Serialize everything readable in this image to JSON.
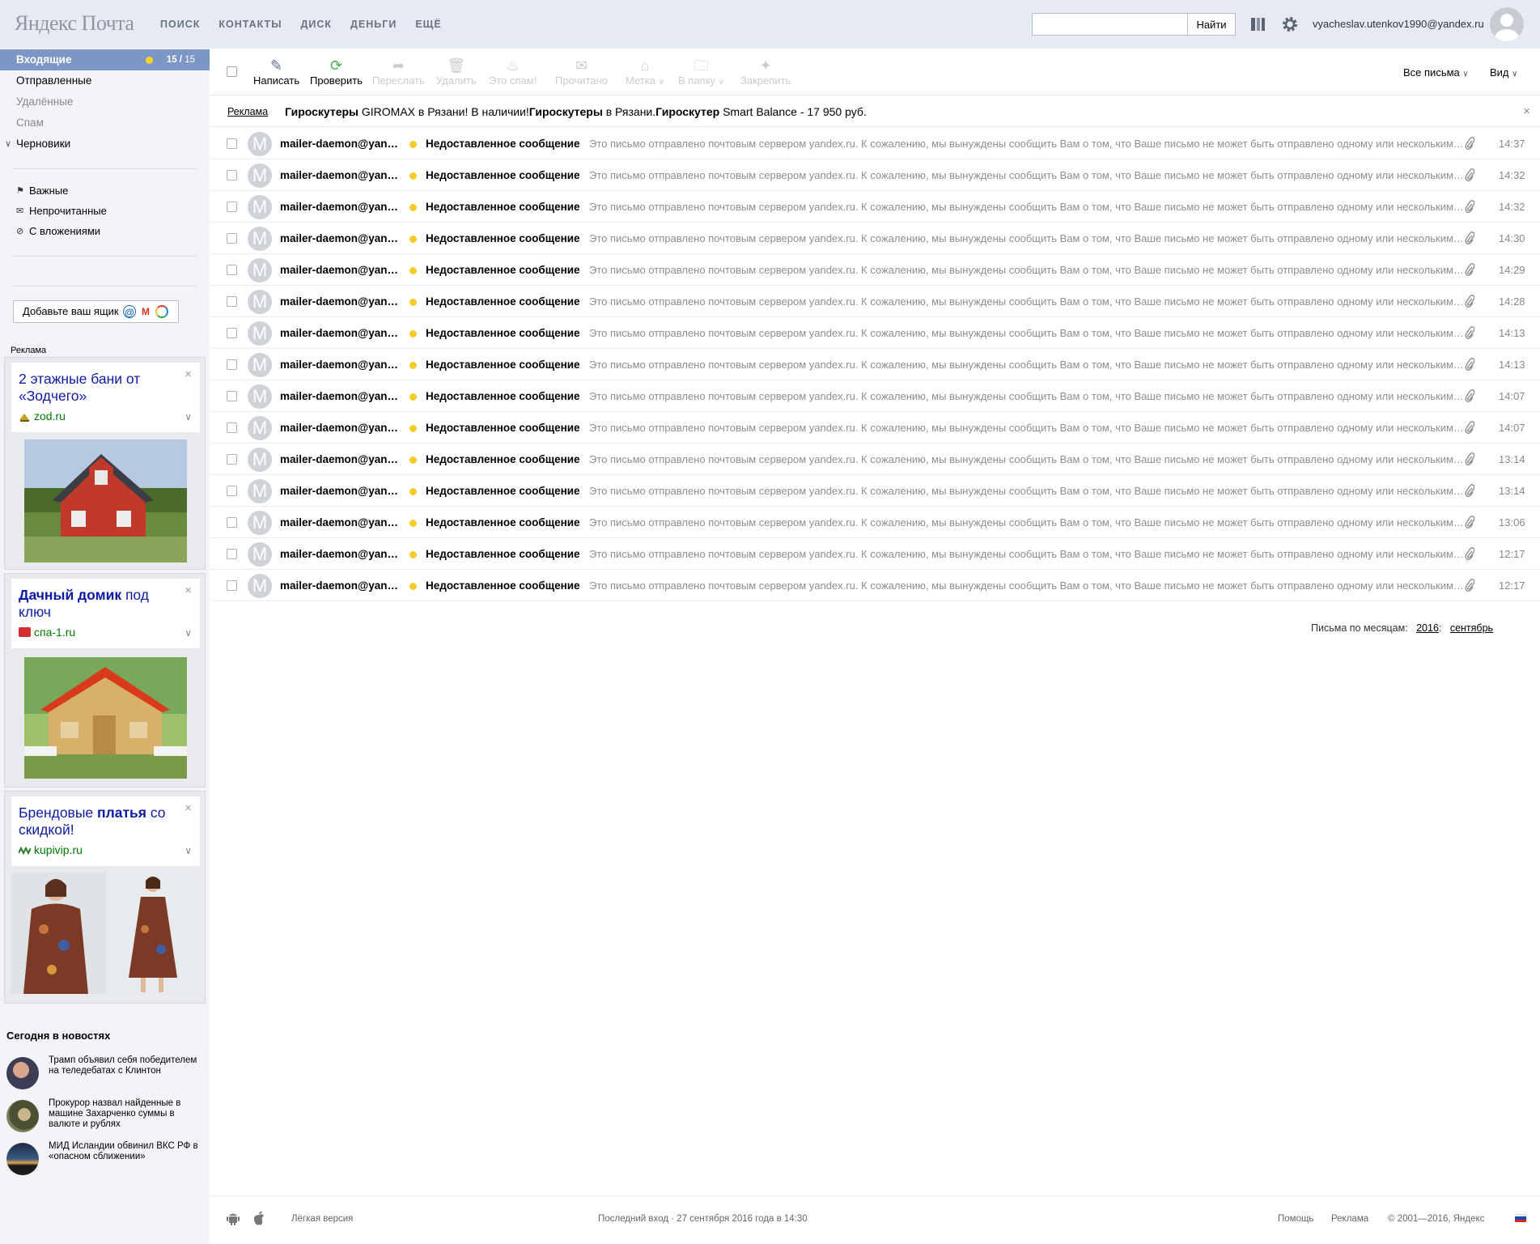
{
  "header": {
    "logo": "Яндекс Почта",
    "nav": [
      "поиск",
      "контакты",
      "диск",
      "деньги",
      "ещё"
    ],
    "search_placeholder": "",
    "search_button": "Найти",
    "user_email": "vyacheslav.utenkov1990@yandex.ru"
  },
  "sidebar": {
    "folders": [
      {
        "label": "Входящие",
        "unread": "15",
        "total": "15",
        "active": true
      },
      {
        "label": "Отправленные"
      },
      {
        "label": "Удалённые"
      },
      {
        "label": "Спам"
      },
      {
        "label": "Черновики"
      }
    ],
    "filters": [
      {
        "label": "Важные",
        "icon": "flag-icon"
      },
      {
        "label": "Непрочитанные",
        "icon": "envelope-icon"
      },
      {
        "label": "С вложениями",
        "icon": "paperclip-icon"
      }
    ],
    "add_mailbox": "Добавьте ваш ящик",
    "ad_label": "Реклама",
    "ads": [
      {
        "title_plain": "2 этажные бани от «Зодчего»",
        "url": "zod.ru"
      },
      {
        "title_bold": "Дачный домик",
        "title_rest": " под ключ",
        "url": "спа-1.ru"
      },
      {
        "title_pre": "Брендовые ",
        "title_bold": "платья",
        "title_rest": " со скидкой!",
        "url": "kupivip.ru"
      }
    ],
    "news_title": "Сегодня в новостях",
    "news": [
      {
        "text": "Трамп объявил себя победителем на теледебатах с Клинтон"
      },
      {
        "text": "Прокурор назвал найденные в машине Захарченко суммы в валюте и рублях"
      },
      {
        "text": "МИД Исландии обвинил ВКС РФ в «опасном сближении»"
      }
    ]
  },
  "toolbar": {
    "compose": "Написать",
    "check": "Проверить",
    "forward": "Переслать",
    "delete": "Удалить",
    "spam": "Это спам!",
    "read": "Прочитано",
    "label": "Метка",
    "to_folder": "В папку",
    "pin": "Закрепить",
    "all_mail": "Все письма",
    "view": "Вид"
  },
  "promo": {
    "label": "Реклама",
    "text_bold1": "Гироскутеры",
    "text_1": " GIROMAX в Рязани! В наличии!",
    "text_bold2": "Гироскутеры",
    "text_2": " в Рязани.",
    "text_bold3": "Гироскутер",
    "text_3": " Smart Balance - 17 950 руб."
  },
  "messages": [
    {
      "from": "mailer-daemon@yandex.ru",
      "subject": "Недоставленное сообщение",
      "snippet": "Это письмо отправлено почтовым сервером yandex.ru. К сожалению, мы вынуждены сообщить Вам о том, что Ваше письмо не может быть отправлено одному или нескольким получателям.",
      "time": "14:37"
    },
    {
      "from": "mailer-daemon@yandex.ru",
      "subject": "Недоставленное сообщение",
      "snippet": "Это письмо отправлено почтовым сервером yandex.ru. К сожалению, мы вынуждены сообщить Вам о том, что Ваше письмо не может быть отправлено одному или нескольким получателям.",
      "time": "14:32"
    },
    {
      "from": "mailer-daemon@yandex.ru",
      "subject": "Недоставленное сообщение",
      "snippet": "Это письмо отправлено почтовым сервером yandex.ru. К сожалению, мы вынуждены сообщить Вам о том, что Ваше письмо не может быть отправлено одному или нескольким получателям.",
      "time": "14:32"
    },
    {
      "from": "mailer-daemon@yandex.ru",
      "subject": "Недоставленное сообщение",
      "snippet": "Это письмо отправлено почтовым сервером yandex.ru. К сожалению, мы вынуждены сообщить Вам о том, что Ваше письмо не может быть отправлено одному или нескольким получателям.",
      "time": "14:30"
    },
    {
      "from": "mailer-daemon@yandex.ru",
      "subject": "Недоставленное сообщение",
      "snippet": "Это письмо отправлено почтовым сервером yandex.ru. К сожалению, мы вынуждены сообщить Вам о том, что Ваше письмо не может быть отправлено одному или нескольким получателям.",
      "time": "14:29"
    },
    {
      "from": "mailer-daemon@yandex.ru",
      "subject": "Недоставленное сообщение",
      "snippet": "Это письмо отправлено почтовым сервером yandex.ru. К сожалению, мы вынуждены сообщить Вам о том, что Ваше письмо не может быть отправлено одному или нескольким получателям.",
      "time": "14:28"
    },
    {
      "from": "mailer-daemon@yandex.ru",
      "subject": "Недоставленное сообщение",
      "snippet": "Это письмо отправлено почтовым сервером yandex.ru. К сожалению, мы вынуждены сообщить Вам о том, что Ваше письмо не может быть отправлено одному или нескольким получателям.",
      "time": "14:13"
    },
    {
      "from": "mailer-daemon@yandex.ru",
      "subject": "Недоставленное сообщение",
      "snippet": "Это письмо отправлено почтовым сервером yandex.ru. К сожалению, мы вынуждены сообщить Вам о том, что Ваше письмо не может быть отправлено одному или нескольким получателям.",
      "time": "14:13"
    },
    {
      "from": "mailer-daemon@yandex.ru",
      "subject": "Недоставленное сообщение",
      "snippet": "Это письмо отправлено почтовым сервером yandex.ru. К сожалению, мы вынуждены сообщить Вам о том, что Ваше письмо не может быть отправлено одному или нескольким получателям.",
      "time": "14:07"
    },
    {
      "from": "mailer-daemon@yandex.ru",
      "subject": "Недоставленное сообщение",
      "snippet": "Это письмо отправлено почтовым сервером yandex.ru. К сожалению, мы вынуждены сообщить Вам о том, что Ваше письмо не может быть отправлено одному или нескольким получателям.",
      "time": "14:07"
    },
    {
      "from": "mailer-daemon@yandex.ru",
      "subject": "Недоставленное сообщение",
      "snippet": "Это письмо отправлено почтовым сервером yandex.ru. К сожалению, мы вынуждены сообщить Вам о том, что Ваше письмо не может быть отправлено одному или нескольким получателям.",
      "time": "13:14"
    },
    {
      "from": "mailer-daemon@yandex.ru",
      "subject": "Недоставленное сообщение",
      "snippet": "Это письмо отправлено почтовым сервером yandex.ru. К сожалению, мы вынуждены сообщить Вам о том, что Ваше письмо не может быть отправлено одному или нескольким получателям.",
      "time": "13:14"
    },
    {
      "from": "mailer-daemon@yandex.ru",
      "subject": "Недоставленное сообщение",
      "snippet": "Это письмо отправлено почтовым сервером yandex.ru. К сожалению, мы вынуждены сообщить Вам о том, что Ваше письмо не может быть отправлено одному или нескольким получателям.",
      "time": "13:06"
    },
    {
      "from": "mailer-daemon@yandex.ru",
      "subject": "Недоставленное сообщение",
      "snippet": "Это письмо отправлено почтовым сервером yandex.ru. К сожалению, мы вынуждены сообщить Вам о том, что Ваше письмо не может быть отправлено одному или нескольким получателям.",
      "time": "12:17"
    },
    {
      "from": "mailer-daemon@yandex.ru",
      "subject": "Недоставленное сообщение",
      "snippet": "Это письмо отправлено почтовым сервером yandex.ru. К сожалению, мы вынуждены сообщить Вам о том, что Ваше письмо не может быть отправлено одному или нескольким получателям.",
      "time": "12:17"
    }
  ],
  "months": {
    "label": "Письма по месяцам:",
    "year": "2016",
    "month": "сентябрь"
  },
  "footer": {
    "lite": "Лёгкая версия",
    "last_login": "Последний вход · 27 сентября 2016 года в 14:30",
    "help": "Помощь",
    "ads": "Реклама",
    "copyright": "© 2001—2016, Яндекс"
  },
  "colors": {
    "accent": "#7c96c6",
    "unread_dot": "#f5cd2a",
    "header_bg": "#e6ebf3",
    "sidebar_bg": "#f2f4f7",
    "ad_link": "#0d1aa7"
  }
}
